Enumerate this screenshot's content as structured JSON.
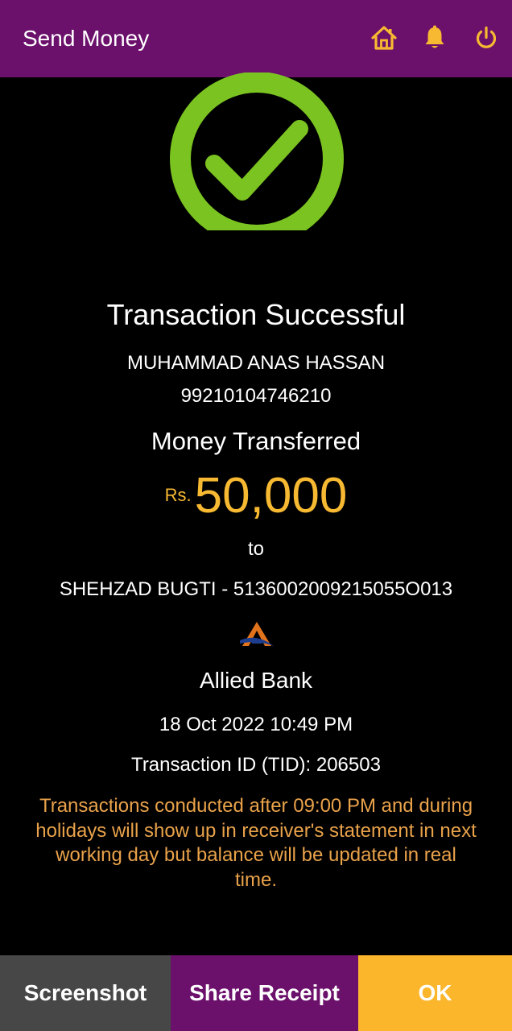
{
  "app_bar": {
    "title": "Send Money",
    "icons": [
      "home-icon",
      "bell-icon",
      "power-icon"
    ]
  },
  "colors": {
    "app_bar": "#6b106b",
    "background": "#000000",
    "accent": "#f7b931",
    "notice": "#e9a24a",
    "success": "#7ac321",
    "screenshot_button": "#474747",
    "share_button": "#6b106b",
    "ok_button": "#fbb62b"
  },
  "receipt": {
    "status": "Transaction Successful",
    "sender_name": "MUHAMMAD ANAS HASSAN",
    "sender_account": "99210104746210",
    "transfer_label": "Money Transferred",
    "currency": "Rs.",
    "amount": "50,000",
    "to_label": "to",
    "receiver": "SHEHZAD BUGTI - 5136002009215055O013",
    "bank_name": "Allied Bank",
    "date": "18 Oct 2022 10:49 PM",
    "transaction_id": "Transaction ID (TID): 206503",
    "notice": "Transactions conducted after 09:00 PM and during holidays will show up in receiver's statement in next working day but balance will be updated in real time."
  },
  "actions": {
    "screenshot": "Screenshot",
    "share": "Share Receipt",
    "ok": "OK"
  }
}
